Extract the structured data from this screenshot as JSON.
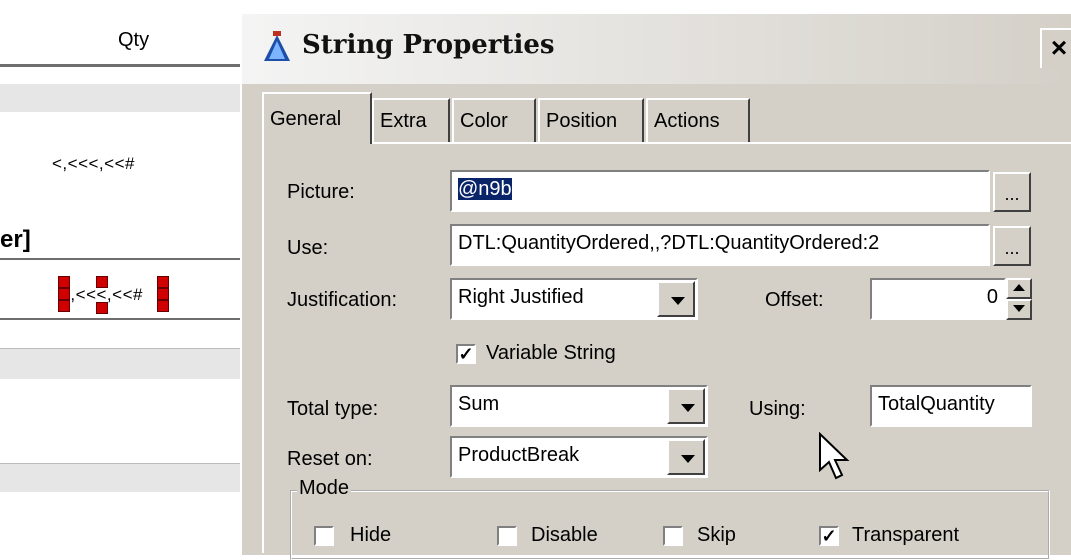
{
  "designer": {
    "column_header": "Qty",
    "detail_picture": "<,<<<,<<#",
    "group_label": "er]",
    "footer_picture": "<,<<<,<<#"
  },
  "dialog": {
    "title": "String Properties",
    "close": "×",
    "tabs": [
      {
        "label": "General",
        "active": true
      },
      {
        "label": "Extra",
        "active": false
      },
      {
        "label": "Color",
        "active": false
      },
      {
        "label": "Position",
        "active": false
      },
      {
        "label": "Actions",
        "active": false
      }
    ],
    "picture": {
      "label": "Picture:",
      "value": "@n9b"
    },
    "use": {
      "label": "Use:",
      "value": "DTL:QuantityOrdered,,?DTL:QuantityOrdered:2"
    },
    "ellipsis": "...",
    "justification": {
      "label": "Justification:",
      "value": "Right Justified"
    },
    "offset": {
      "label": "Offset:",
      "value": "0"
    },
    "variable_string": {
      "label": "Variable String",
      "checked": true
    },
    "total_type": {
      "label": "Total type:",
      "value": "Sum"
    },
    "using": {
      "label": "Using:",
      "value": "TotalQuantity"
    },
    "reset_on": {
      "label": "Reset on:",
      "value": "ProductBreak"
    },
    "mode": {
      "title": "Mode",
      "options": [
        {
          "label": "Hide",
          "checked": false
        },
        {
          "label": "Disable",
          "checked": false
        },
        {
          "label": "Skip",
          "checked": false
        },
        {
          "label": "Transparent",
          "checked": true
        }
      ]
    }
  },
  "check_mark": "✓"
}
